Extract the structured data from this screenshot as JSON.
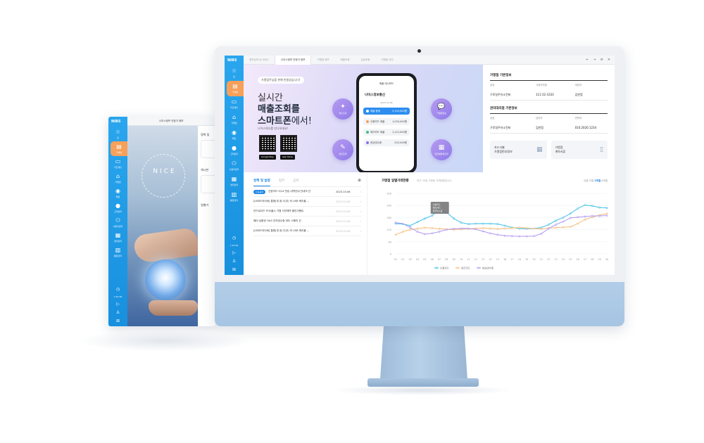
{
  "app": {
    "logo": "NIBS"
  },
  "sidebar": {
    "items": [
      {
        "label": "홈",
        "icon": "star-icon"
      },
      {
        "label": "가맹점",
        "icon": "store-icon"
      },
      {
        "label": "카드매출",
        "icon": "card-icon"
      },
      {
        "label": "가맹점",
        "icon": "shop-icon"
      },
      {
        "label": "매입",
        "icon": "circle-icon"
      },
      {
        "label": "고객관리",
        "icon": "user-icon"
      },
      {
        "label": "사용자관리",
        "icon": "users-icon"
      },
      {
        "label": "경리관리",
        "icon": "calendar-icon"
      },
      {
        "label": "통합관리",
        "icon": "doc-icon"
      }
    ],
    "time": "1:43:36"
  },
  "tabs": [
    {
      "label": "정보검색 내 서비스"
    },
    {
      "label": "나이스정보 인정가 정보",
      "active": true
    },
    {
      "label": "가맹점 정보"
    },
    {
      "label": "매출조회"
    },
    {
      "label": "입금조회"
    },
    {
      "label": "가맹점 관리"
    }
  ],
  "banner": {
    "badge": "가맹점주님을 위해 만들었습니다!",
    "line1": "실시간",
    "line2": "매출조회를",
    "line3a": "스마트폰",
    "line3b": "에서!",
    "line4": "나이스체크를 만나보세요!",
    "store1": "Google Play",
    "store2": "App Store"
  },
  "phone": {
    "title": "매출 대시보드",
    "shop": "나이스정보통신",
    "date": "2023.10.06",
    "rows": [
      {
        "label": "매출 합계",
        "value": "3,105,000원",
        "highlight": true,
        "dot": "#ffffff"
      },
      {
        "label": "신용카드 매출",
        "value": "1,030,000원",
        "dot": "#f6a05a"
      },
      {
        "label": "체크카드 매출",
        "value": "1,122,000원",
        "dot": "#3fbf7f"
      },
      {
        "label": "현금영수증",
        "value": "203,000원",
        "dot": "#8b6cf0"
      }
    ]
  },
  "features": [
    {
      "label": "매출조회",
      "icon": "sparkle-icon"
    },
    {
      "label": "가맹점정보",
      "icon": "chat-icon"
    },
    {
      "label": "입금조회",
      "icon": "feather-icon"
    },
    {
      "label": "입금예정액조회",
      "icon": "calculator-icon"
    }
  ],
  "info": {
    "section1": "가맹점 기본정보",
    "section1_heads": [
      "상호",
      "사업자번호",
      "대표자"
    ],
    "section1_vals": [
      "구로일주유소컨비",
      "111-22-3333",
      "김한힘"
    ],
    "section2": "관리대리점 기본정보",
    "section2_heads": [
      "상호",
      "담당자",
      "연락처"
    ],
    "section2_vals": [
      "구로일주유소컨비",
      "김한힘",
      "010.2020.1234"
    ],
    "card1": "카드사별\n가맹점번호정보",
    "card2": "가맹점\n계약서류"
  },
  "news": {
    "tabs": [
      "정책 및 법령",
      "업무",
      "공지"
    ],
    "items": [
      {
        "tag": "신규공지",
        "text": "신한카드 9/14 반송 내역안내 안내의 건",
        "date": "2023.10.06",
        "highlight": true
      },
      {
        "text": "[USB드라이버] 통합(부,위,이,미) 의 USB 케이블 ...",
        "date": "2023.10.06"
      },
      {
        "text": "안드로이드 POS출시 가맹 사전예약 할인이벤트",
        "date": "2023.10.06"
      },
      {
        "text": "페이·상품권 O&S 전자영수증 계도 시행의 건",
        "date": "2023.10.06"
      },
      {
        "text": "[USB드라이버] 통합(부,위,이,미) 의 USB 케이블 ...",
        "date": "2023.10.06"
      }
    ]
  },
  "chart_data": {
    "type": "line",
    "title": "가맹점 일별거래현황",
    "subtitle": "최근 30일 가맹점 거래현황입니다",
    "selector": [
      "금월",
      "전월",
      "3개월",
      "6개월"
    ],
    "selector_active": "3개월",
    "x": [
      "01",
      "02",
      "03",
      "04",
      "05",
      "06",
      "07",
      "08",
      "09",
      "10",
      "11",
      "12",
      "13",
      "14",
      "15",
      "16",
      "17",
      "18",
      "19",
      "20",
      "21",
      "22",
      "23",
      "24",
      "25",
      "26",
      "27",
      "28",
      "29",
      "30"
    ],
    "ylim": [
      0,
      300
    ],
    "yticks": [
      0,
      60,
      120,
      180,
      240,
      300
    ],
    "tooltip": [
      "신용카드",
      "체크카드",
      "현금영수증"
    ],
    "series": [
      {
        "name": "신용카드",
        "color": "#2bb8e3",
        "values": [
          150,
          148,
          140,
          158,
          175,
          190,
          220,
          205,
          175,
          155,
          148,
          150,
          150,
          150,
          148,
          140,
          130,
          126,
          125,
          126,
          130,
          145,
          165,
          180,
          200,
          225,
          242,
          238,
          230,
          228
        ]
      },
      {
        "name": "체크카드",
        "color": "#f3b36a",
        "values": [
          95,
          110,
          120,
          125,
          130,
          128,
          125,
          122,
          120,
          122,
          124,
          126,
          128,
          126,
          124,
          126,
          128,
          130,
          128,
          126,
          124,
          128,
          130,
          132,
          134,
          150,
          170,
          182,
          192,
          200
        ]
      },
      {
        "name": "현금영수증",
        "color": "#a58bf0",
        "values": [
          155,
          150,
          130,
          110,
          98,
          102,
          110,
          120,
          125,
          126,
          126,
          122,
          112,
          102,
          95,
          90,
          88,
          87,
          87,
          88,
          100,
          125,
          145,
          160,
          178,
          182,
          185,
          188,
          188,
          190
        ]
      }
    ]
  },
  "tablet": {
    "header": "나이스정보 인정가 정보",
    "hero_text": "NICE",
    "panel": [
      "정책 및",
      "게시판",
      "일별거"
    ]
  }
}
